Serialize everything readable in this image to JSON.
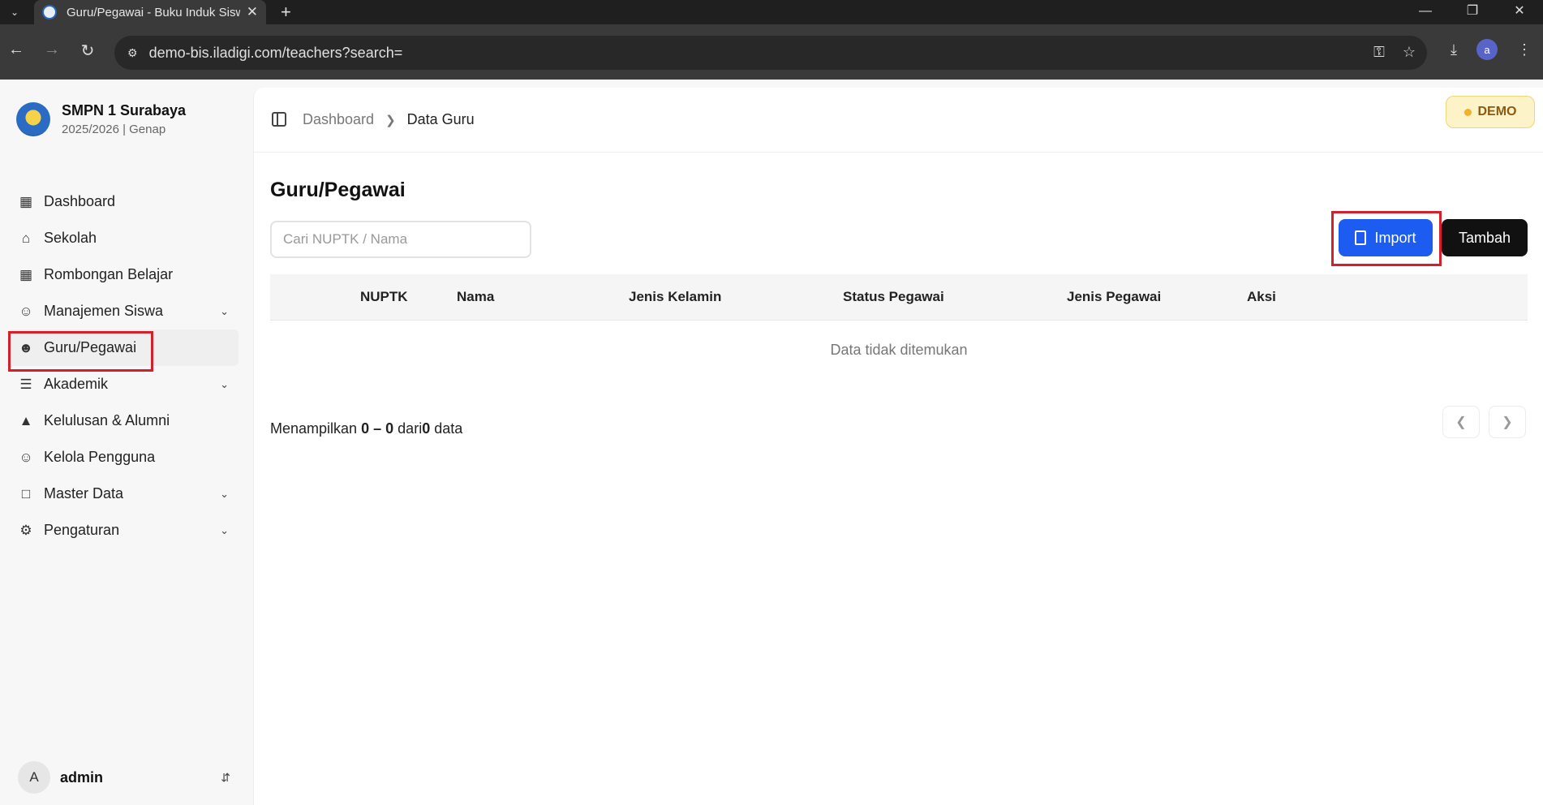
{
  "browser": {
    "tab_title": "Guru/Pegawai - Buku Induk Sisw",
    "url": "demo-bis.iladigi.com/teachers?search=",
    "profile_initial": "a"
  },
  "sidebar": {
    "school_name": "SMPN 1 Surabaya",
    "school_year": "2025/2026 | Genap",
    "items": [
      {
        "label": "Dashboard",
        "icon": "grid-icon"
      },
      {
        "label": "Sekolah",
        "icon": "school-icon"
      },
      {
        "label": "Rombongan Belajar",
        "icon": "grid-icon"
      },
      {
        "label": "Manajemen Siswa",
        "icon": "user-icon",
        "expandable": true
      },
      {
        "label": "Guru/Pegawai",
        "icon": "users-icon",
        "active": true
      },
      {
        "label": "Akademik",
        "icon": "book-icon",
        "expandable": true
      },
      {
        "label": "Kelulusan & Alumni",
        "icon": "graduation-cap-icon"
      },
      {
        "label": "Kelola Pengguna",
        "icon": "user-cog-icon"
      },
      {
        "label": "Master Data",
        "icon": "folder-icon",
        "expandable": true
      },
      {
        "label": "Pengaturan",
        "icon": "gear-icon",
        "expandable": true
      }
    ],
    "user": {
      "initial": "A",
      "name": "admin"
    }
  },
  "header": {
    "breadcrumb_root": "Dashboard",
    "breadcrumb_current": "Data Guru",
    "badge": "DEMO"
  },
  "main": {
    "title": "Guru/Pegawai",
    "search_placeholder": "Cari NUPTK / Nama",
    "import_label": "Import",
    "add_label": "Tambah",
    "columns": [
      "NUPTK",
      "Nama",
      "Jenis Kelamin",
      "Status Pegawai",
      "Jenis Pegawai",
      "Aksi"
    ],
    "empty_text": "Data tidak ditemukan",
    "footer": {
      "prefix": "Menampilkan",
      "from": "0",
      "dash": "–",
      "to": "0",
      "of": "dari",
      "total": "0",
      "suffix": "data"
    }
  },
  "colors": {
    "primary": "#1d5cf0",
    "highlight": "#d4202a",
    "demo_badge": "#fdf3c8"
  }
}
